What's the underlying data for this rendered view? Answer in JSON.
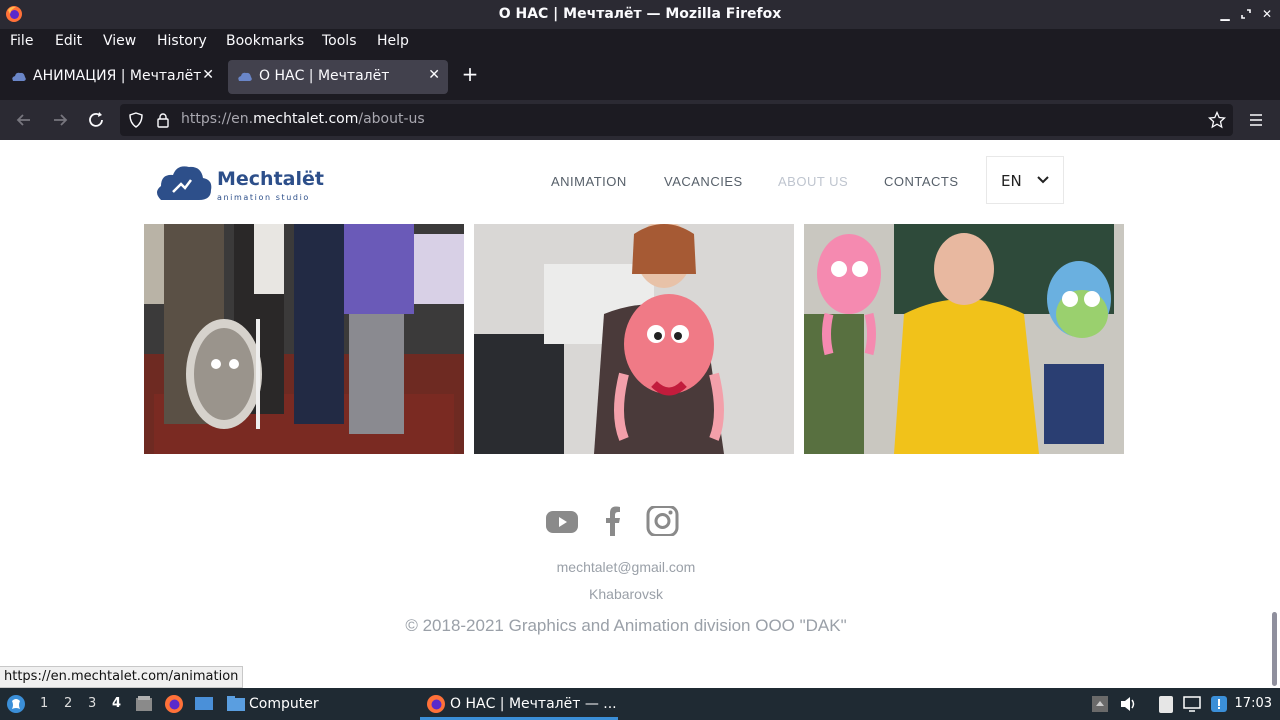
{
  "window": {
    "title": "О НАС | Мечталёт — Mozilla Firefox"
  },
  "menu": {
    "file": "File",
    "edit": "Edit",
    "view": "View",
    "history": "History",
    "bookmarks": "Bookmarks",
    "tools": "Tools",
    "help": "Help"
  },
  "tabs": [
    {
      "label": "АНИМАЦИЯ | Мечталёт",
      "active": false
    },
    {
      "label": "О НАС | Мечталёт",
      "active": true
    }
  ],
  "urlbar": {
    "prefix": "https://en.",
    "host": "mechtalet.com",
    "path": "/about-us"
  },
  "site": {
    "logo_name": "Mechtalёt",
    "logo_sub": "animation studio",
    "nav": {
      "animation": "ANIMATION",
      "vacancies": "VACANCIES",
      "about": "ABOUT US",
      "contacts": "CONTACTS"
    },
    "lang": "EN",
    "footer": {
      "email": "mechtalet@gmail.com",
      "city": "Khabarovsk",
      "copyright": "© 2018-2021 Graphics and Animation division ООО \"DAK\""
    }
  },
  "status_url": "https://en.mechtalet.com/animation",
  "taskbar": {
    "workspaces": [
      "1",
      "2",
      "3",
      "4"
    ],
    "active_workspace": "4",
    "computer_label": "Computer",
    "window_label": "О НАС | Мечталёт — ...",
    "clock": "17:03"
  },
  "colors": {
    "brand": "#2d4f8a",
    "chrome_dark": "#1c1b22",
    "chrome_mid": "#2b2a33"
  },
  "icons": [
    "firefox-icon",
    "minimize-icon",
    "maximize-icon",
    "close-icon",
    "back-icon",
    "forward-icon",
    "reload-icon",
    "shield-icon",
    "lock-icon",
    "star-icon",
    "hamburger-menu-icon",
    "chevron-down-icon",
    "youtube-icon",
    "facebook-icon",
    "instagram-icon"
  ]
}
